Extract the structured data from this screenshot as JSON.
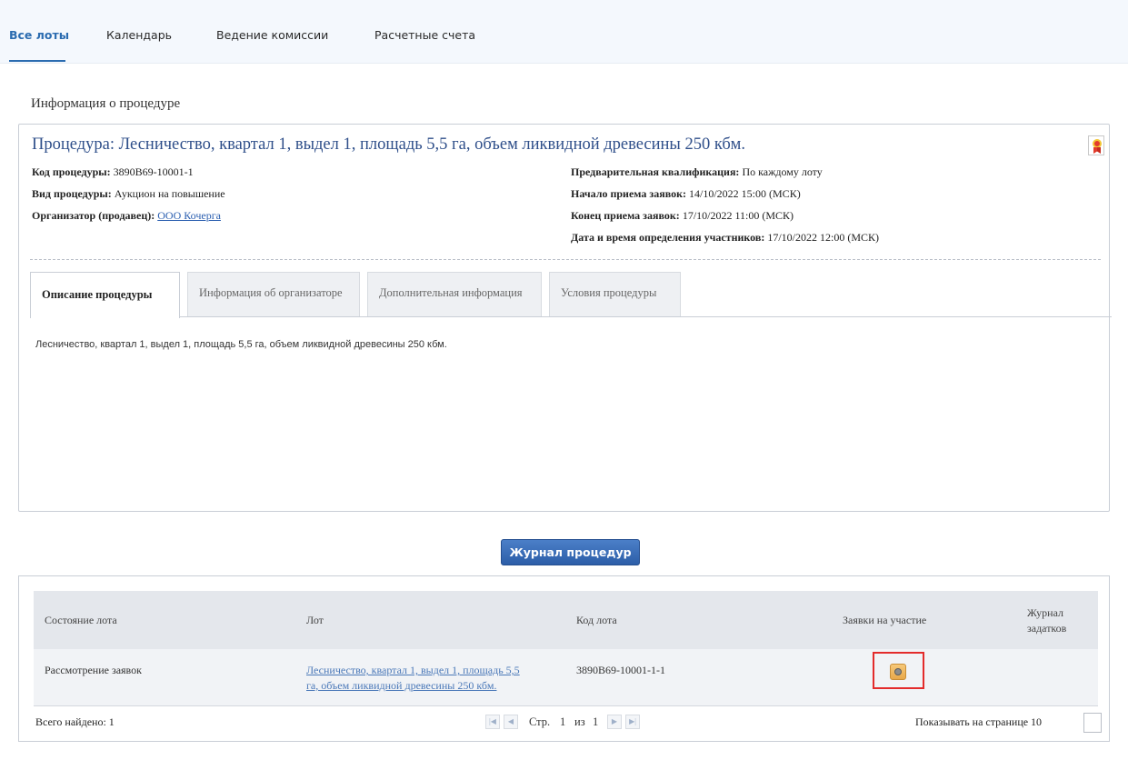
{
  "nav": {
    "tabs": [
      "Все лоты",
      "Календарь",
      "Ведение комиссии",
      "Расчетные счета"
    ]
  },
  "section_title": "Информация о процедуре",
  "procedure": {
    "title": "Процедура: Лесничество, квартал 1, выдел 1, площадь 5,5 га, объем ликвидной древесины 250 кбм.",
    "code_label": "Код процедуры:",
    "code_value": "3890B69-10001-1",
    "type_label": "Вид процедуры:",
    "type_value": "Аукцион на повышение",
    "organizer_label": "Организатор (продавец):",
    "organizer_value": "ООО Кочерга",
    "prequal_label": "Предварительная квалификация:",
    "prequal_value": "По каждому лоту",
    "start_label": "Начало приема заявок:",
    "start_value": "14/10/2022 15:00 (МСК)",
    "end_label": "Конец приема заявок:",
    "end_value": "17/10/2022 11:00 (МСК)",
    "participants_label": "Дата и время определения участников:",
    "participants_value": "17/10/2022 12:00 (МСК)",
    "award_icon": "award-ribbon-icon"
  },
  "subtabs": [
    "Описание процедуры",
    "Информация об организаторе",
    "Дополнительная информация",
    "Условия процедуры"
  ],
  "description": "Лесничество, квартал 1, выдел 1, площадь 5,5 га, объем ликвидной древесины 250 кбм.",
  "journal_button": "Журнал процедур",
  "table": {
    "headers": [
      "Состояние лота",
      "Лот",
      "Код лота",
      "Заявки на участие",
      "Журнал",
      "задатков"
    ],
    "row": {
      "state": "Рассмотрение заявок",
      "lot_line1": "Лесничество, квартал 1, выдел 1, площадь 5,5",
      "lot_line2": "га, объем ликвидной древесины 250 кбм.",
      "code": "3890B69-10001-1-1"
    },
    "total": "Всего найдено: 1",
    "pager": {
      "page_label": "Стр.",
      "page": "1",
      "of_label": "из",
      "pages": "1"
    },
    "per_page_label": "Показывать на странице",
    "per_page_value": "10"
  }
}
